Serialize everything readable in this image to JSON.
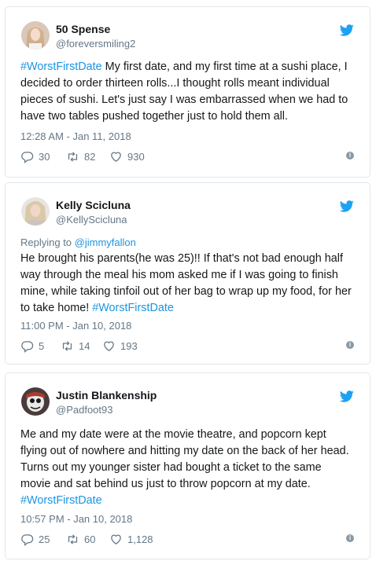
{
  "tweets": [
    {
      "name": "50 Spense",
      "handle": "@foreversmiling2",
      "hashtag_lead": "#WorstFirstDate",
      "text": " My first date, and my first time at a sushi place, I decided to order thirteen rolls...I thought rolls meant individual pieces of sushi. Let's just say I was embarrassed when we had to have two tables pushed together just to hold them all.",
      "timestamp": "12:28 AM - Jan 11, 2018",
      "replies": "30",
      "retweets": "82",
      "likes": "930"
    },
    {
      "name": "Kelly Scicluna",
      "handle": "@KellyScicluna",
      "reply_prefix": "Replying to ",
      "reply_to": "@jimmyfallon",
      "text": "He brought his parents(he was 25)!! If that's not bad enough half way through the meal his mom asked me if I was going to finish mine, while taking tinfoil out of her bag to wrap up my food, for her to take home! ",
      "hashtag_tail": "#WorstFirstDate",
      "timestamp": "11:00 PM - Jan 10, 2018",
      "replies": "5",
      "retweets": "14",
      "likes": "193"
    },
    {
      "name": "Justin Blankenship",
      "handle": "@Padfoot93",
      "text": "Me and my date were at the movie theatre, and popcorn kept flying out of nowhere and hitting my date on the back of her head. Turns out my younger sister had bought a ticket to the same movie and sat behind us just to throw popcorn at my date.",
      "hashtag_tail": "#WorstFirstDate",
      "timestamp": "10:57 PM - Jan 10, 2018",
      "replies": "25",
      "retweets": "60",
      "likes": "1,128"
    }
  ],
  "icons": {
    "brand": "twitter-bird-icon",
    "reply": "reply-icon",
    "retweet": "retweet-icon",
    "like": "heart-icon",
    "info": "info-icon"
  },
  "colors": {
    "brand_blue": "#1da1f2",
    "link_blue": "#1b95e0",
    "muted": "#657786",
    "border": "#e1e8ed"
  }
}
